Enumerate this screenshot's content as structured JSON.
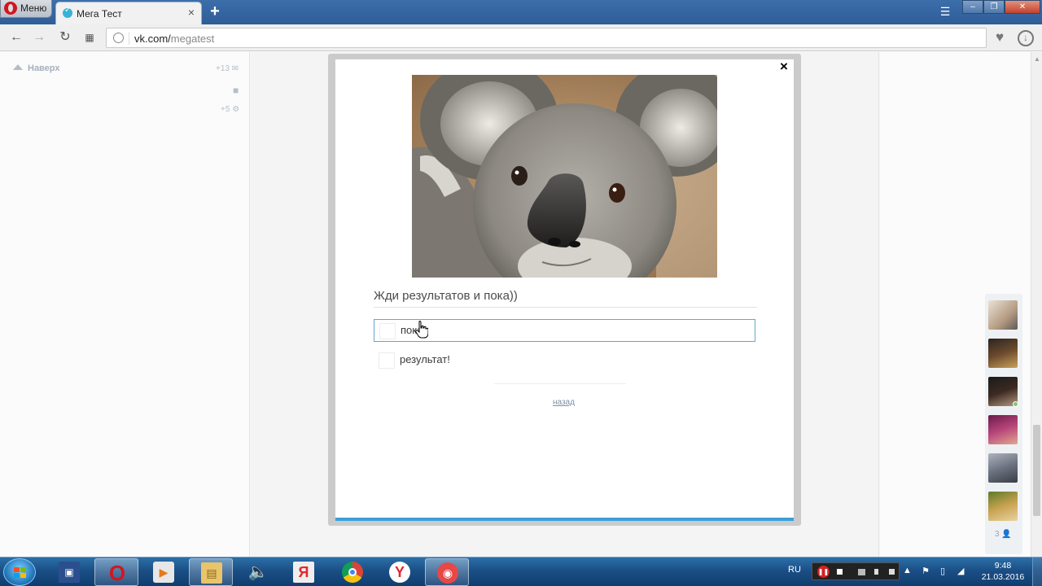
{
  "browser": {
    "menu_label": "Меню",
    "tab_title": "Мега Тест",
    "tab_close": "×",
    "new_tab": "+",
    "url_host": "vk.com/",
    "url_path": "megatest"
  },
  "left_sidebar": {
    "top_link": "Наверх",
    "messages_count": "+13",
    "settings_count": "+5"
  },
  "modal": {
    "close": "×",
    "question": "Жди результатов и пока))",
    "answers": [
      {
        "label": "пока",
        "selected": true
      },
      {
        "label": "результат!",
        "selected": false
      }
    ],
    "back_link": "назад",
    "accent_color": "#3ba0d8"
  },
  "friends": {
    "count": "3"
  },
  "taskbar": {
    "language": "RU",
    "time": "9:48",
    "date": "21.03.2016",
    "apps": [
      "save-icon",
      "opera-icon",
      "media-player-icon",
      "explorer-icon",
      "speaker-icon",
      "yandex-icon",
      "chrome-icon",
      "yandex-browser-icon",
      "record-icon"
    ]
  }
}
